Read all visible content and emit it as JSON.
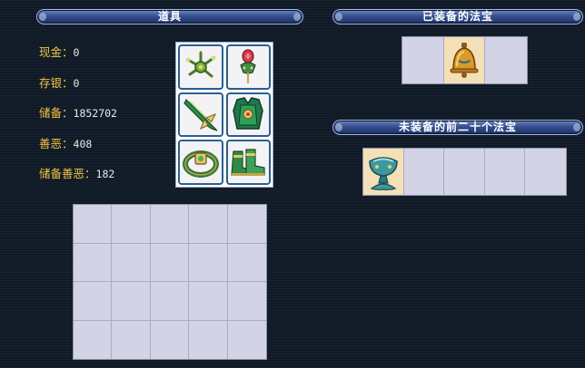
{
  "panels": {
    "items_title": "道具",
    "equipped_title": "已装备的法宝",
    "unequipped_title": "未装备的前二十个法宝"
  },
  "stats": [
    {
      "label": "现金：",
      "value": "0"
    },
    {
      "label": "存银：",
      "value": "0"
    },
    {
      "label": "储备：",
      "value": "1852702"
    },
    {
      "label": "善恶：",
      "value": "408"
    },
    {
      "label": "储备善恶：",
      "value": "182"
    }
  ],
  "equipment_icons": [
    "hair-ornament-icon",
    "hairpin-icon",
    "jade-weapon-icon",
    "armor-vest-icon",
    "jade-belt-icon",
    "boots-icon"
  ],
  "equipped_treasures": [
    "",
    "bell-icon",
    ""
  ],
  "unequipped_treasures": [
    "bowl-treasure-icon",
    "",
    "",
    "",
    ""
  ],
  "colors": {
    "stat_label": "#f2c442",
    "stat_value": "#e8e8e8",
    "slot_fill": "#d3d3e6",
    "filled_cell": "#f4dfb6"
  }
}
